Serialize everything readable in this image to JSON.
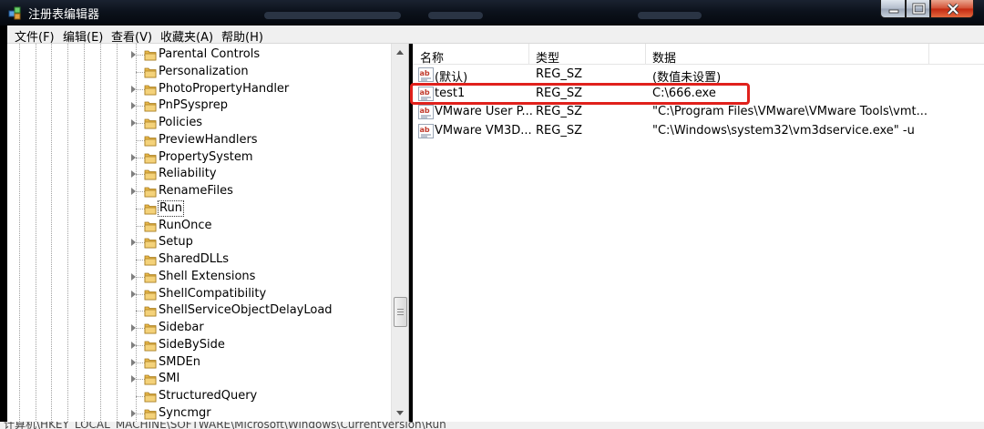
{
  "window": {
    "title": "注册表编辑器"
  },
  "menu": [
    "文件(F)",
    "编辑(E)",
    "查看(V)",
    "收藏夹(A)",
    "帮助(H)"
  ],
  "tree": {
    "items": [
      {
        "label": "Parental Controls",
        "expandable": true
      },
      {
        "label": "Personalization",
        "expandable": false
      },
      {
        "label": "PhotoPropertyHandler",
        "expandable": true
      },
      {
        "label": "PnPSysprep",
        "expandable": true
      },
      {
        "label": "Policies",
        "expandable": true
      },
      {
        "label": "PreviewHandlers",
        "expandable": false
      },
      {
        "label": "PropertySystem",
        "expandable": true
      },
      {
        "label": "Reliability",
        "expandable": true
      },
      {
        "label": "RenameFiles",
        "expandable": true
      },
      {
        "label": "Run",
        "expandable": false,
        "selected": true
      },
      {
        "label": "RunOnce",
        "expandable": false
      },
      {
        "label": "Setup",
        "expandable": true
      },
      {
        "label": "SharedDLLs",
        "expandable": false
      },
      {
        "label": "Shell Extensions",
        "expandable": true
      },
      {
        "label": "ShellCompatibility",
        "expandable": true
      },
      {
        "label": "ShellServiceObjectDelayLoad",
        "expandable": false
      },
      {
        "label": "Sidebar",
        "expandable": true
      },
      {
        "label": "SideBySide",
        "expandable": true
      },
      {
        "label": "SMDEn",
        "expandable": true
      },
      {
        "label": "SMI",
        "expandable": true
      },
      {
        "label": "StructuredQuery",
        "expandable": false
      },
      {
        "label": "Syncmgr",
        "expandable": true
      }
    ]
  },
  "list": {
    "columns": [
      "名称",
      "类型",
      "数据"
    ],
    "rows": [
      {
        "name": "(默认)",
        "type": "REG_SZ",
        "data": "(数值未设置)"
      },
      {
        "name": "test1",
        "type": "REG_SZ",
        "data": "C:\\666.exe"
      },
      {
        "name": "VMware User P...",
        "type": "REG_SZ",
        "data": "\"C:\\Program Files\\VMware\\VMware Tools\\vmt..."
      },
      {
        "name": "VMware VM3D...",
        "type": "REG_SZ",
        "data": "\"C:\\Windows\\system32\\vm3dservice.exe\" -u"
      }
    ]
  },
  "statusbar": {
    "path": "计算机\\HKEY_LOCAL_MACHINE\\SOFTWARE\\Microsoft\\Windows\\CurrentVersion\\Run"
  },
  "colors": {
    "highlight": "#e0211c",
    "folder": "#e8b84a"
  },
  "icons": {
    "tree_item": "folder-icon",
    "value": "string-value-icon",
    "app": "registry-editor-icon"
  }
}
